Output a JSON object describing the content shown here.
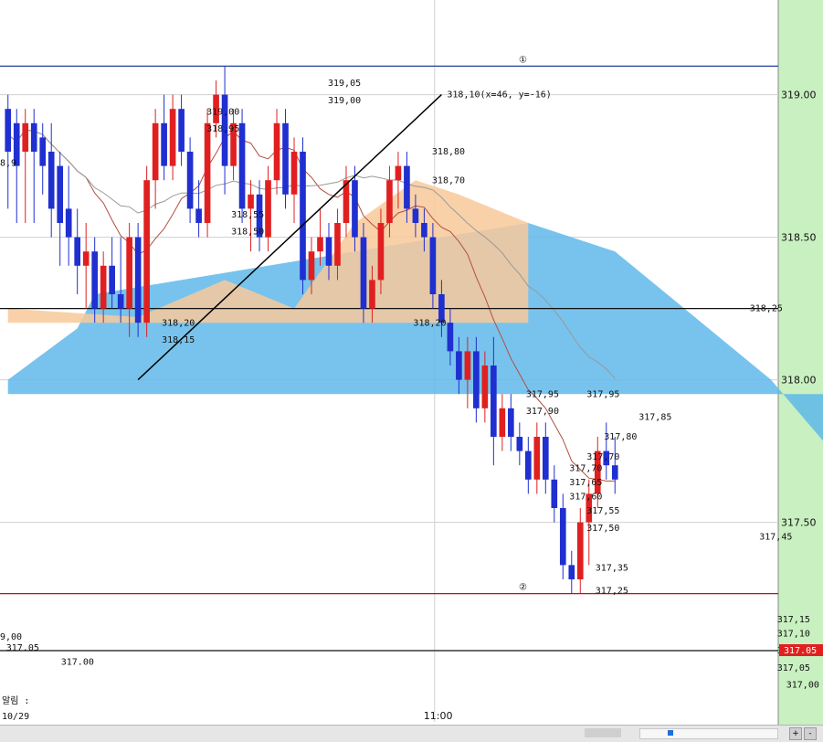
{
  "chart_data": {
    "type": "candlestick",
    "y_axis": {
      "ticks": [
        "319.00",
        "318.50",
        "318.00",
        "317.50"
      ],
      "tick_values": [
        319.0,
        318.5,
        318.0,
        317.5
      ],
      "range": [
        316.8,
        319.3
      ]
    },
    "x_axis": {
      "time_labels": [
        "11:00"
      ]
    },
    "candles": [
      {
        "o": 318.95,
        "h": 319.0,
        "l": 318.6,
        "c": 318.8
      },
      {
        "o": 318.9,
        "h": 318.95,
        "l": 318.55,
        "c": 318.75
      },
      {
        "o": 318.8,
        "h": 318.95,
        "l": 318.55,
        "c": 318.9
      },
      {
        "o": 318.9,
        "h": 318.95,
        "l": 318.55,
        "c": 318.8
      },
      {
        "o": 318.85,
        "h": 318.9,
        "l": 318.65,
        "c": 318.75
      },
      {
        "o": 318.8,
        "h": 318.9,
        "l": 318.5,
        "c": 318.6
      },
      {
        "o": 318.75,
        "h": 318.8,
        "l": 318.4,
        "c": 318.55
      },
      {
        "o": 318.6,
        "h": 318.75,
        "l": 318.4,
        "c": 318.5
      },
      {
        "o": 318.5,
        "h": 318.6,
        "l": 318.3,
        "c": 318.4
      },
      {
        "o": 318.4,
        "h": 318.55,
        "l": 318.25,
        "c": 318.45
      },
      {
        "o": 318.45,
        "h": 318.5,
        "l": 318.2,
        "c": 318.25
      },
      {
        "o": 318.25,
        "h": 318.45,
        "l": 318.2,
        "c": 318.4
      },
      {
        "o": 318.4,
        "h": 318.5,
        "l": 318.25,
        "c": 318.3
      },
      {
        "o": 318.3,
        "h": 318.5,
        "l": 318.2,
        "c": 318.25
      },
      {
        "o": 318.25,
        "h": 318.55,
        "l": 318.15,
        "c": 318.5
      },
      {
        "o": 318.5,
        "h": 318.55,
        "l": 318.15,
        "c": 318.2
      },
      {
        "o": 318.2,
        "h": 318.75,
        "l": 318.15,
        "c": 318.7
      },
      {
        "o": 318.7,
        "h": 318.95,
        "l": 318.6,
        "c": 318.9
      },
      {
        "o": 318.9,
        "h": 319.0,
        "l": 318.7,
        "c": 318.75
      },
      {
        "o": 318.75,
        "h": 319.0,
        "l": 318.7,
        "c": 318.95
      },
      {
        "o": 318.95,
        "h": 319.0,
        "l": 318.75,
        "c": 318.8
      },
      {
        "o": 318.8,
        "h": 318.85,
        "l": 318.55,
        "c": 318.6
      },
      {
        "o": 318.6,
        "h": 318.7,
        "l": 318.5,
        "c": 318.55
      },
      {
        "o": 318.55,
        "h": 318.95,
        "l": 318.5,
        "c": 318.9
      },
      {
        "o": 318.9,
        "h": 319.05,
        "l": 318.85,
        "c": 319.0
      },
      {
        "o": 319.0,
        "h": 319.1,
        "l": 318.65,
        "c": 318.75
      },
      {
        "o": 318.75,
        "h": 318.95,
        "l": 318.7,
        "c": 318.9
      },
      {
        "o": 318.9,
        "h": 318.95,
        "l": 318.55,
        "c": 318.6
      },
      {
        "o": 318.6,
        "h": 318.7,
        "l": 318.45,
        "c": 318.65
      },
      {
        "o": 318.65,
        "h": 318.7,
        "l": 318.45,
        "c": 318.5
      },
      {
        "o": 318.5,
        "h": 318.75,
        "l": 318.45,
        "c": 318.7
      },
      {
        "o": 318.7,
        "h": 318.95,
        "l": 318.65,
        "c": 318.9
      },
      {
        "o": 318.9,
        "h": 318.95,
        "l": 318.6,
        "c": 318.65
      },
      {
        "o": 318.65,
        "h": 318.85,
        "l": 318.55,
        "c": 318.8
      },
      {
        "o": 318.8,
        "h": 318.85,
        "l": 318.3,
        "c": 318.35
      },
      {
        "o": 318.35,
        "h": 318.5,
        "l": 318.3,
        "c": 318.45
      },
      {
        "o": 318.45,
        "h": 318.6,
        "l": 318.4,
        "c": 318.5
      },
      {
        "o": 318.5,
        "h": 318.55,
        "l": 318.35,
        "c": 318.4
      },
      {
        "o": 318.4,
        "h": 318.6,
        "l": 318.35,
        "c": 318.55
      },
      {
        "o": 318.55,
        "h": 318.75,
        "l": 318.5,
        "c": 318.7
      },
      {
        "o": 318.7,
        "h": 318.75,
        "l": 318.45,
        "c": 318.5
      },
      {
        "o": 318.5,
        "h": 318.55,
        "l": 318.2,
        "c": 318.25
      },
      {
        "o": 318.25,
        "h": 318.4,
        "l": 318.2,
        "c": 318.35
      },
      {
        "o": 318.35,
        "h": 318.6,
        "l": 318.3,
        "c": 318.55
      },
      {
        "o": 318.55,
        "h": 318.75,
        "l": 318.5,
        "c": 318.7
      },
      {
        "o": 318.7,
        "h": 318.8,
        "l": 318.6,
        "c": 318.75
      },
      {
        "o": 318.75,
        "h": 318.8,
        "l": 318.55,
        "c": 318.6
      },
      {
        "o": 318.6,
        "h": 318.65,
        "l": 318.5,
        "c": 318.55
      },
      {
        "o": 318.55,
        "h": 318.6,
        "l": 318.45,
        "c": 318.5
      },
      {
        "o": 318.5,
        "h": 318.55,
        "l": 318.25,
        "c": 318.3
      },
      {
        "o": 318.3,
        "h": 318.35,
        "l": 318.15,
        "c": 318.2
      },
      {
        "o": 318.2,
        "h": 318.25,
        "l": 318.05,
        "c": 318.1
      },
      {
        "o": 318.1,
        "h": 318.15,
        "l": 317.95,
        "c": 318.0
      },
      {
        "o": 318.0,
        "h": 318.15,
        "l": 317.9,
        "c": 318.1
      },
      {
        "o": 318.1,
        "h": 318.15,
        "l": 317.85,
        "c": 317.9
      },
      {
        "o": 317.9,
        "h": 318.1,
        "l": 317.85,
        "c": 318.05
      },
      {
        "o": 318.05,
        "h": 318.15,
        "l": 317.7,
        "c": 317.8
      },
      {
        "o": 317.8,
        "h": 317.95,
        "l": 317.75,
        "c": 317.9
      },
      {
        "o": 317.9,
        "h": 317.95,
        "l": 317.75,
        "c": 317.8
      },
      {
        "o": 317.8,
        "h": 317.85,
        "l": 317.7,
        "c": 317.75
      },
      {
        "o": 317.75,
        "h": 317.8,
        "l": 317.6,
        "c": 317.65
      },
      {
        "o": 317.65,
        "h": 317.85,
        "l": 317.6,
        "c": 317.8
      },
      {
        "o": 317.8,
        "h": 317.85,
        "l": 317.6,
        "c": 317.65
      },
      {
        "o": 317.65,
        "h": 317.7,
        "l": 317.5,
        "c": 317.55
      },
      {
        "o": 317.55,
        "h": 317.6,
        "l": 317.3,
        "c": 317.35
      },
      {
        "o": 317.35,
        "h": 317.4,
        "l": 317.25,
        "c": 317.3
      },
      {
        "o": 317.3,
        "h": 317.55,
        "l": 317.25,
        "c": 317.5
      },
      {
        "o": 317.5,
        "h": 317.65,
        "l": 317.35,
        "c": 317.6
      },
      {
        "o": 317.6,
        "h": 317.8,
        "l": 317.55,
        "c": 317.75
      },
      {
        "o": 317.75,
        "h": 317.85,
        "l": 317.65,
        "c": 317.7
      },
      {
        "o": 317.7,
        "h": 317.8,
        "l": 317.6,
        "c": 317.65
      }
    ],
    "cloud": {
      "orange": [
        [
          0,
          318.25
        ],
        [
          15,
          318.22
        ],
        [
          25,
          318.35
        ],
        [
          33,
          318.25
        ],
        [
          40,
          318.55
        ],
        [
          47,
          318.7
        ],
        [
          52,
          318.65
        ],
        [
          60,
          318.55
        ]
      ],
      "blue": [
        [
          0,
          318.0
        ],
        [
          8,
          318.18
        ],
        [
          10,
          318.3
        ],
        [
          60,
          318.55
        ],
        [
          70,
          318.45
        ],
        [
          80,
          318.2
        ],
        [
          88,
          318.0
        ],
        [
          95,
          317.75
        ]
      ]
    },
    "trend_line": {
      "label": "318,10(x=46, y=-16)"
    },
    "price_labels": [
      {
        "t": "319,00"
      },
      {
        "t": "318,95"
      },
      {
        "t": "319,05"
      },
      {
        "t": "319,00"
      },
      {
        "t": "318,80"
      },
      {
        "t": "318,70"
      },
      {
        "t": "318,55"
      },
      {
        "t": "318,50"
      },
      {
        "t": "318,20"
      },
      {
        "t": "318,15"
      },
      {
        "t": "318,20"
      },
      {
        "t": "318,25"
      },
      {
        "t": "317,95"
      },
      {
        "t": "317,95"
      },
      {
        "t": "317,90"
      },
      {
        "t": "317,85"
      },
      {
        "t": "317,80"
      },
      {
        "t": "317,70"
      },
      {
        "t": "317,70"
      },
      {
        "t": "317,65"
      },
      {
        "t": "317,60"
      },
      {
        "t": "317,55"
      },
      {
        "t": "317,50"
      },
      {
        "t": "317,45"
      },
      {
        "t": "317,35"
      },
      {
        "t": "317,25"
      },
      {
        "t": "317,15"
      },
      {
        "t": "317,10"
      },
      {
        "t": "317,05"
      },
      {
        "t": "317,05"
      },
      {
        "t": "317,00"
      },
      {
        "t": "317.05"
      },
      {
        "t": "317.00"
      }
    ],
    "markers": [
      "①",
      "②"
    ],
    "right_axis_flag": "317.05",
    "left_fragments": [
      "9,00",
      "8,9",
      "3",
      "2",
      "3",
      "2",
      "2",
      "2",
      "2",
      "3",
      "3",
      "2",
      "2"
    ],
    "footer_left": "알림 :",
    "footer_date": "10/29"
  }
}
